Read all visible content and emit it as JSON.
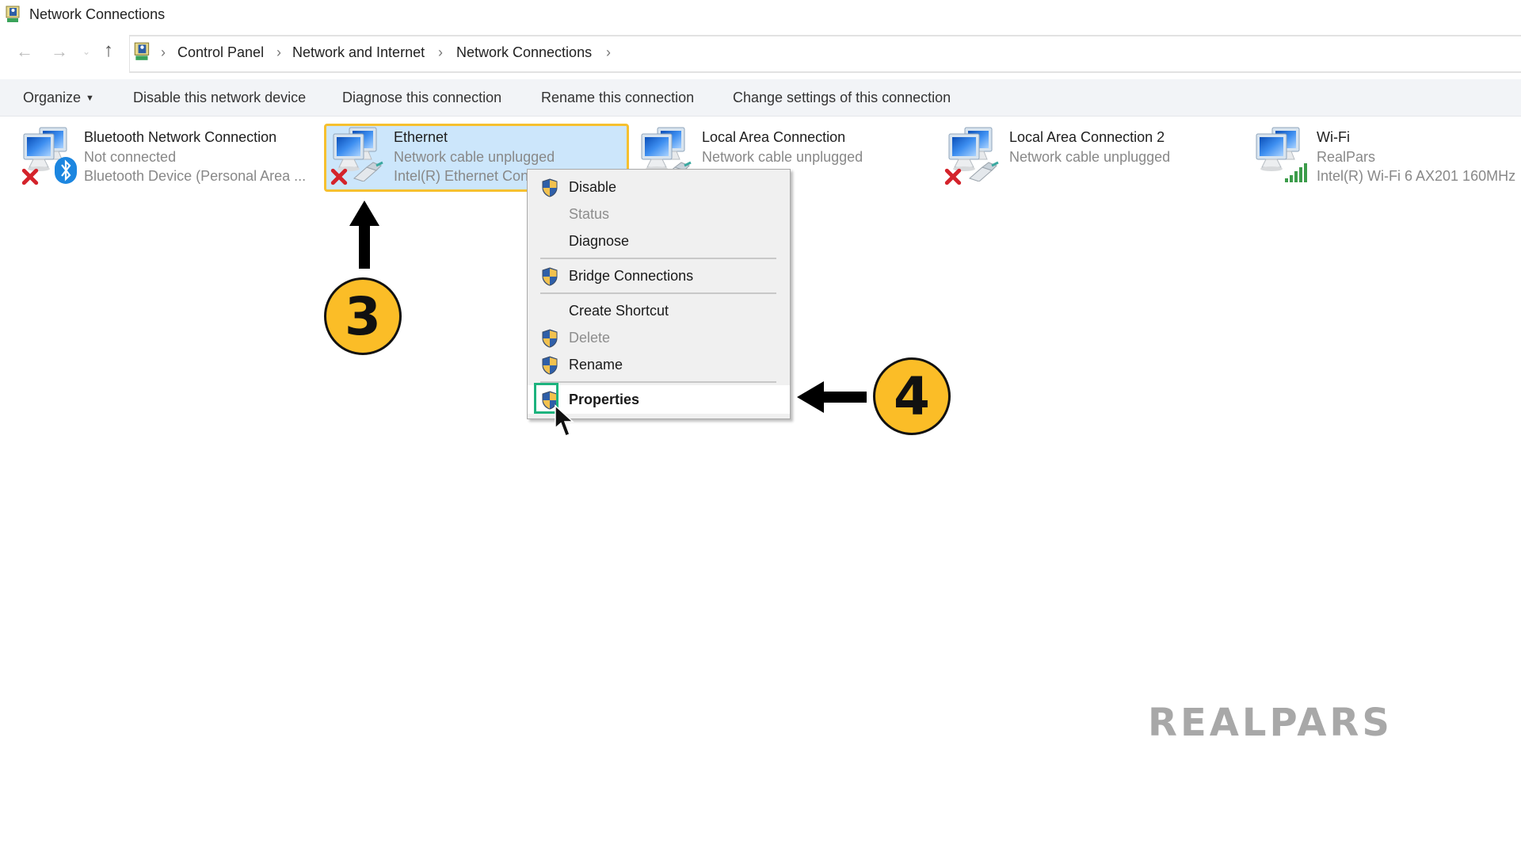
{
  "window": {
    "title": "Network Connections",
    "icon": "network-connections-icon"
  },
  "navigation": {
    "back_icon": "arrow-left-icon",
    "forward_icon": "arrow-right-icon",
    "recent_icon": "chevron-down-icon",
    "up_icon": "arrow-up-icon",
    "back_glyph": "←",
    "forward_glyph": "→",
    "recent_glyph": "⌄",
    "up_glyph": "↑"
  },
  "breadcrumb": {
    "separator": "›",
    "items": [
      "Control Panel",
      "Network and Internet",
      "Network Connections"
    ]
  },
  "toolbar": {
    "organize": "Organize",
    "organize_caret": "▼",
    "disable_device": "Disable this network device",
    "diagnose": "Diagnose this connection",
    "rename": "Rename this connection",
    "change_settings": "Change settings of this connection"
  },
  "connections": [
    {
      "name": "Bluetooth Network Connection",
      "status": "Not connected",
      "device": "Bluetooth Device (Personal Area ...",
      "overlay": "bluetooth-icon",
      "error": true,
      "selected": false
    },
    {
      "name": "Ethernet",
      "status": "Network cable unplugged",
      "device": "Intel(R) Ethernet Con",
      "overlay": "ethernet-cable-icon",
      "error": true,
      "selected": true
    },
    {
      "name": "Local Area Connection",
      "status": "Network cable unplugged",
      "device": "",
      "overlay": "ethernet-cable-icon",
      "error": false,
      "selected": false
    },
    {
      "name": "Local Area Connection 2",
      "status": "Network cable unplugged",
      "device": "",
      "overlay": "ethernet-cable-icon",
      "error": true,
      "selected": false
    },
    {
      "name": "Wi-Fi",
      "status": "RealPars",
      "device": "Intel(R) Wi-Fi 6 AX201 160MHz",
      "overlay": "wifi-signal-icon",
      "error": false,
      "selected": false
    }
  ],
  "context_menu": {
    "items": [
      {
        "label": "Disable",
        "shield": true,
        "enabled": true,
        "bold": false
      },
      {
        "label": "Status",
        "shield": false,
        "enabled": false,
        "bold": false
      },
      {
        "label": "Diagnose",
        "shield": false,
        "enabled": true,
        "bold": false
      },
      {
        "label": "Bridge Connections",
        "shield": true,
        "enabled": true,
        "bold": false
      },
      {
        "label": "Create Shortcut",
        "shield": false,
        "enabled": true,
        "bold": false
      },
      {
        "label": "Delete",
        "shield": true,
        "enabled": false,
        "bold": false
      },
      {
        "label": "Rename",
        "shield": true,
        "enabled": true,
        "bold": false
      },
      {
        "label": "Properties",
        "shield": true,
        "enabled": true,
        "bold": true,
        "hovered": true
      }
    ]
  },
  "annotations": {
    "step_3": "3",
    "step_4": "4",
    "badge_color": "#fbbd27",
    "highlight_color": "#1db37e",
    "selection_border_color": "#f6c02f"
  },
  "watermark": {
    "text": "REALPARS"
  }
}
